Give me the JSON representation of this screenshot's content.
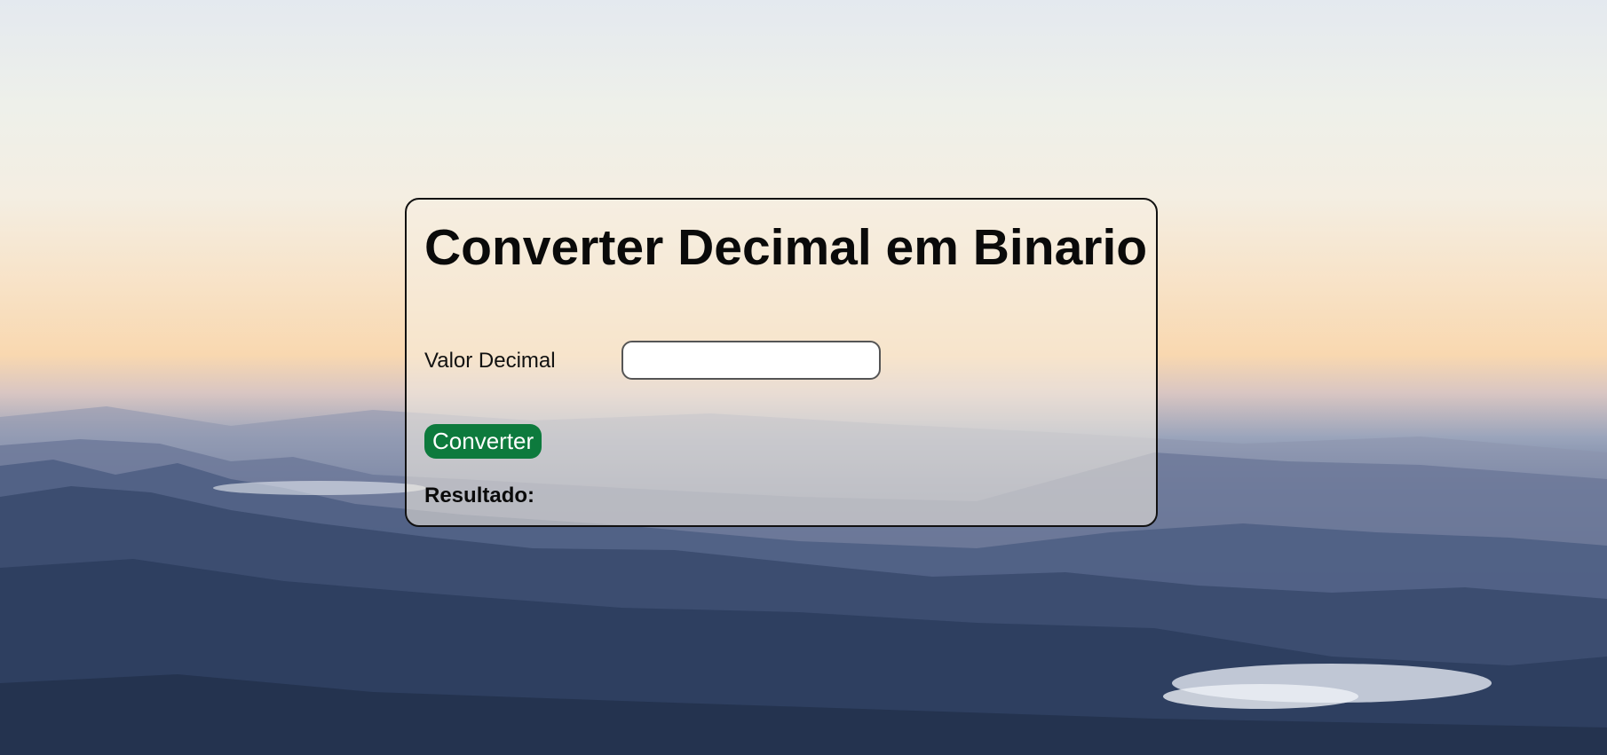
{
  "page": {
    "title": "Converter Decimal em Binario"
  },
  "form": {
    "decimal_label": "Valor Decimal",
    "decimal_value": "",
    "convert_button_label": "Converter",
    "result_label": "Resultado:",
    "result_value": ""
  },
  "colors": {
    "button_background": "#0d7a3d",
    "button_text": "#ffffff",
    "card_border": "#111111"
  }
}
